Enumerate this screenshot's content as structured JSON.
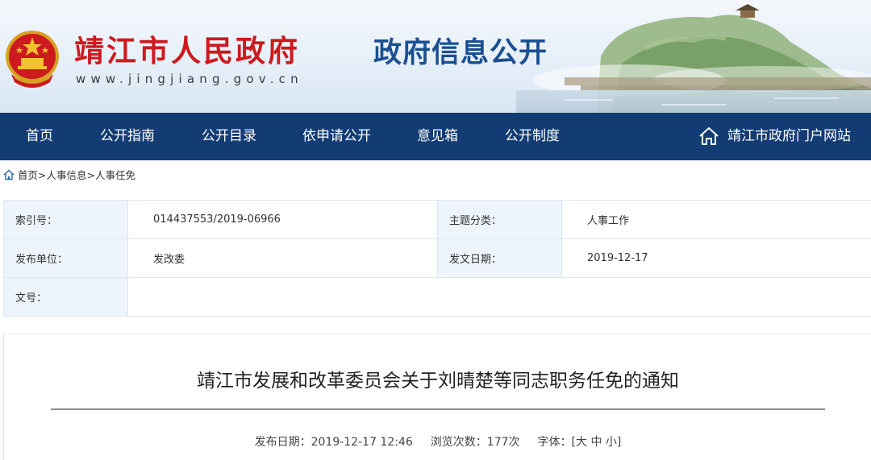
{
  "header": {
    "site_name": "靖江市人民政府",
    "site_url": "www.jingjiang.gov.cn",
    "section_title": "政府信息公开"
  },
  "nav": {
    "items": [
      "首页",
      "公开指南",
      "公开目录",
      "依申请公开",
      "意见箱",
      "公开制度"
    ],
    "portal_label": "靖江市政府门户网站"
  },
  "breadcrumb": {
    "items": [
      "首页",
      "人事信息",
      "人事任免"
    ],
    "separator": ">"
  },
  "info": {
    "index_label": "索引号：",
    "index_value": "014437553/2019-06966",
    "topic_label": "主题分类：",
    "topic_value": "人事工作",
    "publisher_label": "发布单位：",
    "publisher_value": "发改委",
    "date_label": "发文日期：",
    "date_value": "2019-12-17",
    "docno_label": "文号：",
    "docno_value": ""
  },
  "article": {
    "title": "靖江市发展和改革委员会关于刘晴楚等同志职务任免的通知",
    "publish_label": "发布日期：",
    "publish_value": "2019-12-17 12:46",
    "views_label": "浏览次数：",
    "views_value": "177次",
    "font_label": "字体：",
    "font_open": "[",
    "font_large": "大",
    "font_medium": "中",
    "font_small": "小",
    "font_close": "]"
  },
  "colors": {
    "brand_red": "#cc1a1e",
    "title_blue": "#1b4f93",
    "nav_bg": "#123c73",
    "label_bg": "#eef4fb",
    "border": "#dde6ef"
  },
  "icons": {
    "emblem": "national-emblem-icon",
    "portal": "home-icon",
    "breadcrumb": "home-icon"
  }
}
